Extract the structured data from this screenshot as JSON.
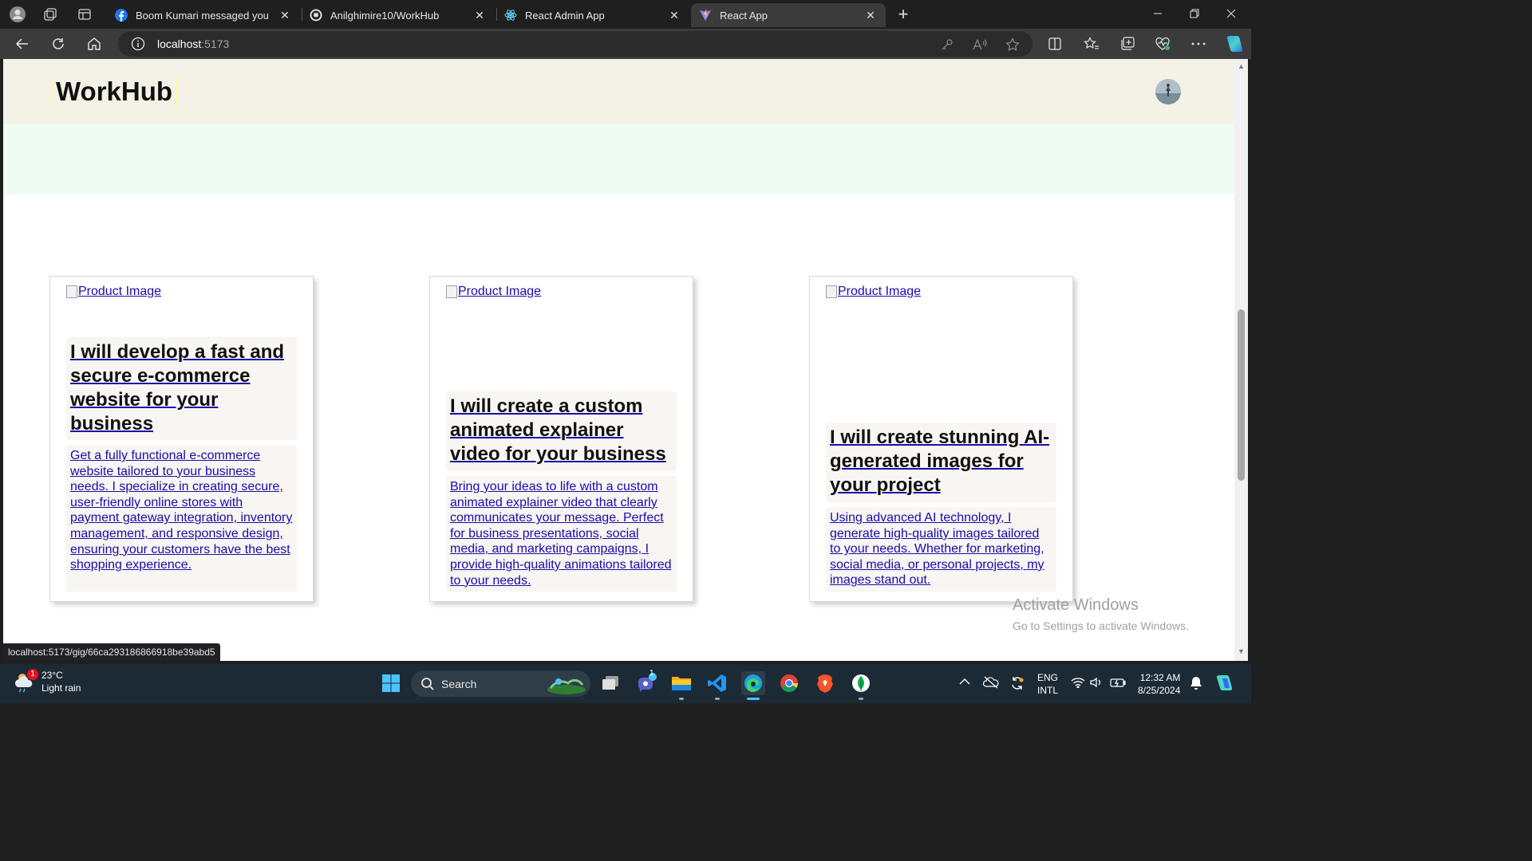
{
  "browser": {
    "tabs": [
      {
        "title": "Boom Kumari messaged you",
        "icon": "facebook-icon"
      },
      {
        "title": "Anilghimire10/WorkHub",
        "icon": "github-icon"
      },
      {
        "title": "React Admin App",
        "icon": "react-icon"
      },
      {
        "title": "React App",
        "icon": "vite-icon",
        "active": true
      }
    ],
    "new_tab_label": "+",
    "url_host": "localhost",
    "url_port": ":5173",
    "status_url": "localhost:5173/gig/66ca293186866918be39abd5"
  },
  "site": {
    "brand": "WorkHub",
    "avatar_icon": "user-avatar-icon"
  },
  "gigs": [
    {
      "image_alt": "Product Image",
      "title": "I will develop a fast and secure e-commerce website for your business",
      "description": "Get a fully functional e-commerce website tailored to your business needs. I specialize in creating secure, user-friendly online stores with payment gateway integration, inventory management, and responsive design, ensuring your customers have the best shopping experience."
    },
    {
      "image_alt": "Product Image",
      "title": "I will create a custom animated explainer video for your business",
      "description": "Bring your ideas to life with a custom animated explainer video that clearly communicates your message. Perfect for business presentations, social media, and marketing campaigns, I provide high-quality animations tailored to your needs."
    },
    {
      "image_alt": "Product Image",
      "title": "I will create stunning AI-generated images for your project",
      "description": "Using advanced AI technology, I generate high-quality images tailored to your needs. Whether for marketing, social media, or personal projects, my images stand out."
    }
  ],
  "watermark": {
    "line1": "Activate Windows",
    "line2": "Go to Settings to activate Windows."
  },
  "taskbar": {
    "weather_temp": "23°C",
    "weather_desc": "Light rain",
    "weather_badge": "1",
    "search_label": "Search",
    "teams_badge": "1",
    "lang_line1": "ENG",
    "lang_line2": "INTL",
    "time": "12:32 AM",
    "date": "8/25/2024"
  },
  "colors": {
    "header_bg": "#f4f2e6",
    "hero_bg": "#effcf4",
    "link": "#1a0dab",
    "taskbar_bg": "#1c2a35"
  }
}
